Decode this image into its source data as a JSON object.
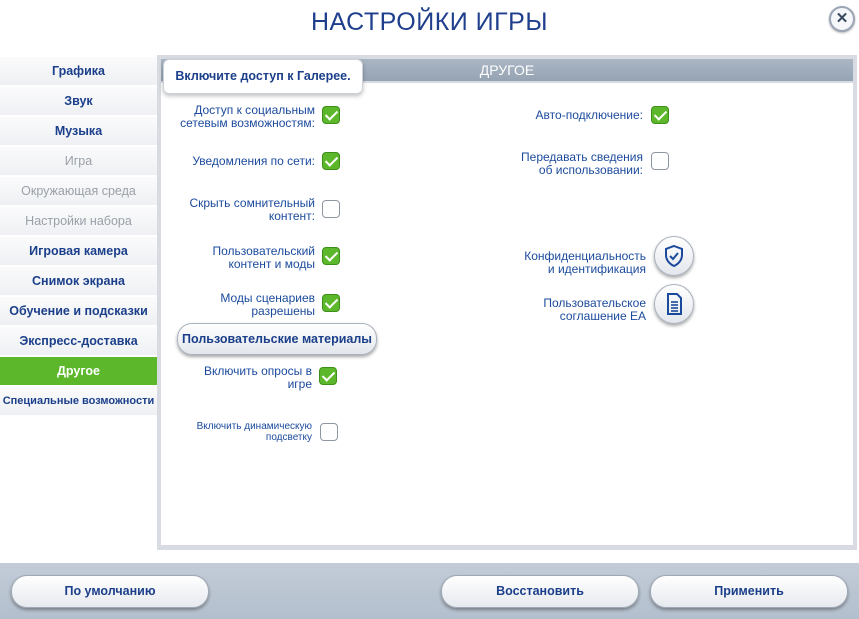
{
  "title": "Настройки игры",
  "close_label": "✕",
  "sidebar": {
    "items": [
      {
        "label": "Графика"
      },
      {
        "label": "Звук"
      },
      {
        "label": "Музыка"
      },
      {
        "label": "Игра"
      },
      {
        "label": "Окружающая среда"
      },
      {
        "label": "Настройки набора"
      },
      {
        "label": "Игровая камера"
      },
      {
        "label": "Снимок экрана"
      },
      {
        "label": "Обучение и подсказки"
      },
      {
        "label": "Экспресс-доставка"
      },
      {
        "label": "Другое"
      },
      {
        "label": "Специальные возможности"
      }
    ],
    "active": "Другое"
  },
  "panel": {
    "title": "Другое",
    "tooltip": "Включите доступ к Галерее.",
    "left_options": [
      {
        "line1": "Доступ к социальным",
        "line2": "сетевым возможностям:",
        "checked": true
      },
      {
        "line1": "Уведомления по сети:",
        "line2": "",
        "checked": true
      },
      {
        "line1": "Скрыть сомнительный",
        "line2": "контент:",
        "checked": false
      },
      {
        "line1": "Пользовательский",
        "line2": "контент и моды",
        "checked": true
      },
      {
        "line1": "Моды сценариев",
        "line2": "разрешены",
        "checked": true
      },
      {
        "line1": "Включить опросы в",
        "line2": "игре",
        "checked": true
      },
      {
        "line1": "Включить динамическую",
        "line2": "подсветку",
        "checked": false
      }
    ],
    "custom_materials_button": "Пользовательские материалы",
    "right_options": [
      {
        "line1": "Авто-подключение:",
        "line2": "",
        "checked": true
      },
      {
        "line1": "Передавать сведения",
        "line2": "об использовании:",
        "checked": false
      }
    ],
    "links": [
      {
        "line1": "Конфиденциальность",
        "line2": "и идентификация",
        "icon": "shield-check-icon"
      },
      {
        "line1": "Пользовательское",
        "line2": "соглашение EA",
        "icon": "document-icon"
      }
    ]
  },
  "footer": {
    "defaults_label": "По умолчанию",
    "restore_label": "Восстановить",
    "apply_label": "Применить"
  },
  "colors": {
    "accent": "#5cb82a",
    "text_blue": "#1b3f8a",
    "header_bar": "#9fadbd"
  }
}
